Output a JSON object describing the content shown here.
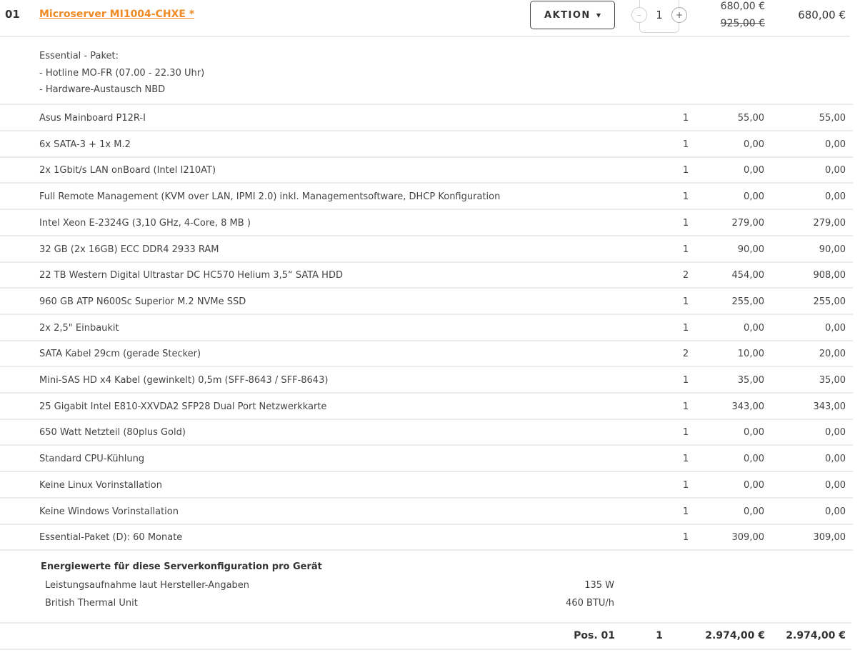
{
  "position": {
    "number": "01",
    "product_title": "Microserver MI1004-CHXE  *",
    "action_label": "AKTION",
    "quantity": "1",
    "minus_label": "–",
    "plus_label": "+",
    "price_now": "680,00 €",
    "price_old": "925,00 €",
    "price_total": "680,00 €"
  },
  "package": {
    "line1": "Essential - Paket:",
    "line2": "- Hotline MO-FR (07.00 - 22.30 Uhr)",
    "line3": "- Hardware-Austausch NBD"
  },
  "items": [
    {
      "desc": "Asus Mainboard P12R-I",
      "qty": "1",
      "unit": "55,00",
      "sum": "55,00"
    },
    {
      "desc": "6x SATA-3 + 1x M.2",
      "qty": "1",
      "unit": "0,00",
      "sum": "0,00"
    },
    {
      "desc": "2x 1Gbit/s LAN onBoard (Intel I210AT)",
      "qty": "1",
      "unit": "0,00",
      "sum": "0,00"
    },
    {
      "desc": "Full Remote Management (KVM over LAN, IPMI 2.0) inkl. Managementsoftware, DHCP Konfiguration",
      "qty": "1",
      "unit": "0,00",
      "sum": "0,00"
    },
    {
      "desc": "Intel Xeon E-2324G (3,10 GHz, 4-Core, 8 MB )",
      "qty": "1",
      "unit": "279,00",
      "sum": "279,00"
    },
    {
      "desc": "32 GB (2x 16GB) ECC DDR4 2933 RAM",
      "qty": "1",
      "unit": "90,00",
      "sum": "90,00"
    },
    {
      "desc": "22 TB Western Digital Ultrastar DC HC570 Helium 3,5“ SATA HDD",
      "qty": "2",
      "unit": "454,00",
      "sum": "908,00"
    },
    {
      "desc": "960 GB ATP N600Sc Superior M.2 NVMe SSD",
      "qty": "1",
      "unit": "255,00",
      "sum": "255,00"
    },
    {
      "desc": "2x 2,5\" Einbaukit",
      "qty": "1",
      "unit": "0,00",
      "sum": "0,00"
    },
    {
      "desc": "SATA Kabel 29cm (gerade Stecker)",
      "qty": "2",
      "unit": "10,00",
      "sum": "20,00"
    },
    {
      "desc": "Mini-SAS HD x4 Kabel (gewinkelt) 0,5m (SFF-8643 / SFF-8643)",
      "qty": "1",
      "unit": "35,00",
      "sum": "35,00"
    },
    {
      "desc": "25 Gigabit Intel E810-XXVDA2 SFP28 Dual Port Netzwerkkarte",
      "qty": "1",
      "unit": "343,00",
      "sum": "343,00"
    },
    {
      "desc": "650 Watt Netzteil (80plus Gold)",
      "qty": "1",
      "unit": "0,00",
      "sum": "0,00"
    },
    {
      "desc": "Standard CPU-Kühlung",
      "qty": "1",
      "unit": "0,00",
      "sum": "0,00"
    },
    {
      "desc": "Keine Linux Vorinstallation",
      "qty": "1",
      "unit": "0,00",
      "sum": "0,00"
    },
    {
      "desc": "Keine Windows Vorinstallation",
      "qty": "1",
      "unit": "0,00",
      "sum": "0,00"
    },
    {
      "desc": "Essential-Paket (D): 60 Monate",
      "qty": "1",
      "unit": "309,00",
      "sum": "309,00"
    }
  ],
  "energy": {
    "title": "Energiewerte für diese Serverkonfiguration pro Gerät",
    "power_label": "Leistungsaufnahme laut Hersteller-Angaben",
    "power_value": "135 W",
    "btu_label": "British Thermal Unit",
    "btu_value": "460 BTU/h"
  },
  "footer": {
    "pos_label": "Pos. 01",
    "qty": "1",
    "unit_total": "2.974,00 €",
    "sum_total": "2.974,00 €"
  },
  "colors": {
    "accent": "#f08a24",
    "separator": "#ececec"
  }
}
